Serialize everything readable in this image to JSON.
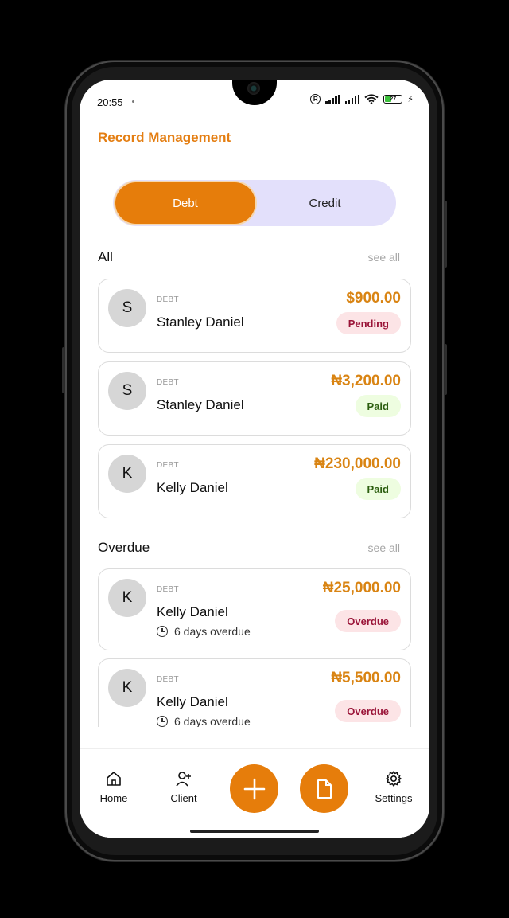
{
  "status_bar": {
    "time": "20:55",
    "battery": "27"
  },
  "header": {
    "title": "Record Management"
  },
  "toggle": {
    "debt_label": "Debt",
    "credit_label": "Credit",
    "selected": "Debt"
  },
  "sections": {
    "all": {
      "title": "All",
      "see_all": "see all",
      "items": [
        {
          "initial": "S",
          "type": "DEBT",
          "name": "Stanley Daniel",
          "amount": "$900.00",
          "status": "Pending"
        },
        {
          "initial": "S",
          "type": "DEBT",
          "name": "Stanley Daniel",
          "amount": "₦3,200.00",
          "status": "Paid"
        },
        {
          "initial": "K",
          "type": "DEBT",
          "name": "Kelly Daniel",
          "amount": "₦230,000.00",
          "status": "Paid"
        }
      ]
    },
    "overdue": {
      "title": "Overdue",
      "see_all": "see all",
      "items": [
        {
          "initial": "K",
          "type": "DEBT",
          "name": "Kelly Daniel",
          "amount": "₦25,000.00",
          "status": "Overdue",
          "due": "6 days overdue"
        },
        {
          "initial": "K",
          "type": "DEBT",
          "name": "Kelly Daniel",
          "amount": "₦5,500.00",
          "status": "Overdue",
          "due": "6 days overdue"
        }
      ]
    }
  },
  "nav": {
    "home": "Home",
    "client": "Client",
    "settings": "Settings"
  },
  "colors": {
    "accent": "#e67d0b",
    "toggle_bg": "#e3e0fb",
    "amount": "#d98413"
  }
}
